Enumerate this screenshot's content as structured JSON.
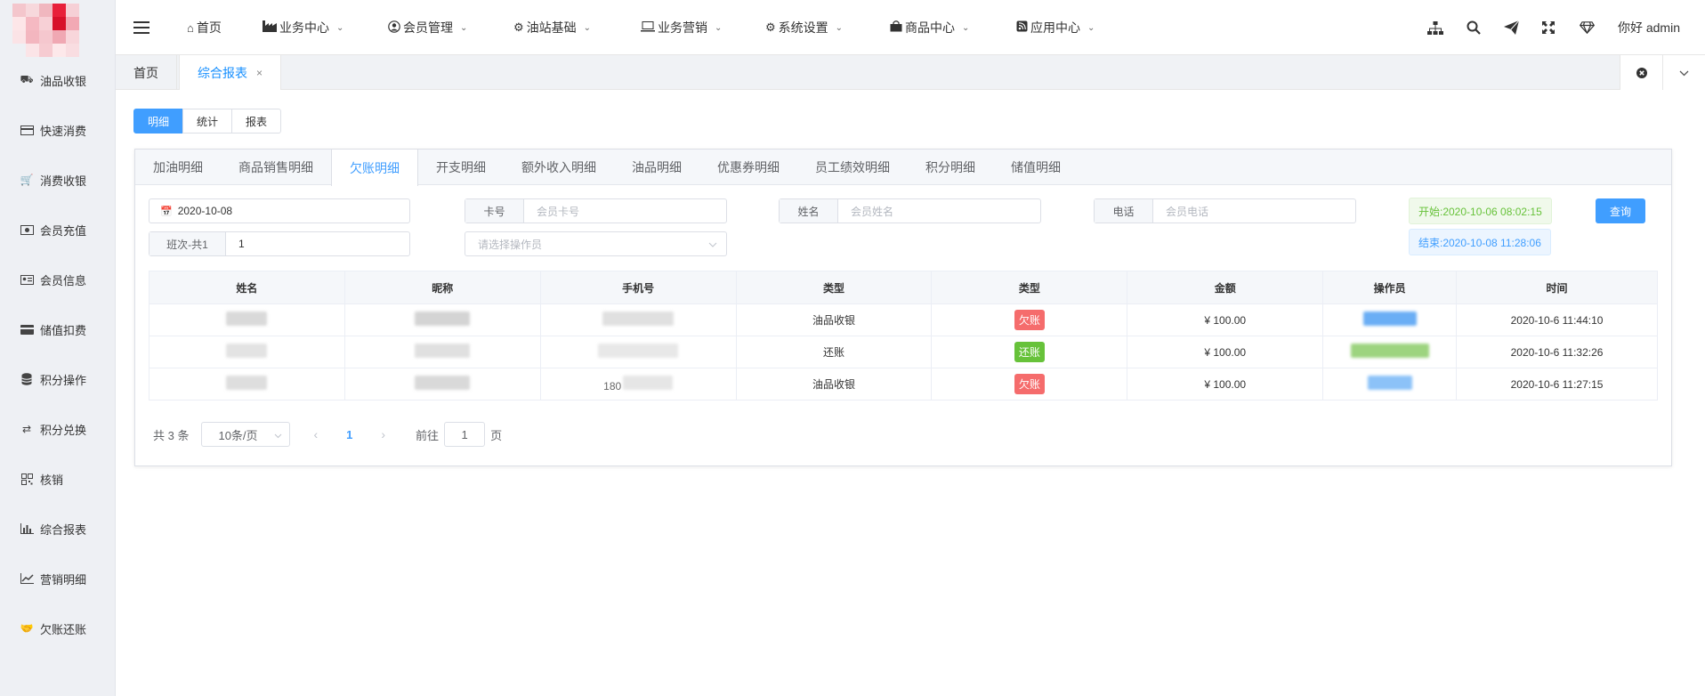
{
  "colors": {
    "accent": "#409eff",
    "debt": "#f56c6c",
    "repay": "#67c23a"
  },
  "sidebar": {
    "items": [
      {
        "label": "油品收银",
        "icon": "truck-icon"
      },
      {
        "label": "快速消费",
        "icon": "credit-card-icon"
      },
      {
        "label": "消费收银",
        "icon": "cart-icon"
      },
      {
        "label": "会员充值",
        "icon": "money-icon"
      },
      {
        "label": "会员信息",
        "icon": "id-card-icon"
      },
      {
        "label": "储值扣费",
        "icon": "card-icon"
      },
      {
        "label": "积分操作",
        "icon": "database-icon"
      },
      {
        "label": "积分兑换",
        "icon": "exchange-icon"
      },
      {
        "label": "核销",
        "icon": "qrcode-icon"
      },
      {
        "label": "综合报表",
        "icon": "bar-chart-icon"
      },
      {
        "label": "营销明细",
        "icon": "line-chart-icon"
      },
      {
        "label": "欠账还账",
        "icon": "handshake-icon"
      }
    ]
  },
  "topnav": {
    "items": [
      {
        "label": "首页",
        "icon": "home-icon",
        "dropdown": false
      },
      {
        "label": "业务中心",
        "icon": "industry-icon",
        "dropdown": true
      },
      {
        "label": "会员管理",
        "icon": "user-circle-icon",
        "dropdown": true
      },
      {
        "label": "油站基础",
        "icon": "gear-icon",
        "dropdown": true
      },
      {
        "label": "业务营销",
        "icon": "laptop-icon",
        "dropdown": true
      },
      {
        "label": "系统设置",
        "icon": "gear-icon",
        "dropdown": true
      },
      {
        "label": "商品中心",
        "icon": "shopping-bag-icon",
        "dropdown": true
      },
      {
        "label": "应用中心",
        "icon": "rss-icon",
        "dropdown": true
      }
    ],
    "greeting": "你好 admin"
  },
  "tabs": {
    "home": "首页",
    "current": "综合报表",
    "close": "×"
  },
  "segment": [
    "明细",
    "统计",
    "报表"
  ],
  "subtabs": [
    "加油明细",
    "商品销售明细",
    "欠账明细",
    "开支明细",
    "额外收入明细",
    "油品明细",
    "优惠券明细",
    "员工绩效明细",
    "积分明细",
    "储值明细"
  ],
  "filters": {
    "date": "2020-10-08",
    "card_label": "卡号",
    "card_placeholder": "会员卡号",
    "name_label": "姓名",
    "name_placeholder": "会员姓名",
    "phone_label": "电话",
    "phone_placeholder": "会员电话",
    "shift_label": "班次-共1",
    "shift_value": "1",
    "operator_placeholder": "请选择操作员",
    "start": "开始:2020-10-06 08:02:15",
    "end": "结束:2020-10-08 11:28:06",
    "query": "查询"
  },
  "table": {
    "headers": [
      "姓名",
      "昵称",
      "手机号",
      "类型",
      "类型",
      "金额",
      "操作员",
      "时间"
    ],
    "rows": [
      {
        "biz": "油品收银",
        "tag": "欠账",
        "tag_type": "debt",
        "amount": "¥ 100.00",
        "time": "2020-10-6 11:44:10",
        "phone": ""
      },
      {
        "biz": "还账",
        "tag": "还账",
        "tag_type": "repay",
        "amount": "¥ 100.00",
        "time": "2020-10-6 11:32:26",
        "phone": ""
      },
      {
        "biz": "油品收银",
        "tag": "欠账",
        "tag_type": "debt",
        "amount": "¥ 100.00",
        "time": "2020-10-6 11:27:15",
        "phone": "180"
      }
    ]
  },
  "pager": {
    "total": "共 3 条",
    "size": "10条/页",
    "current": "1",
    "goto_prefix": "前往",
    "goto_value": "1",
    "goto_suffix": "页"
  }
}
